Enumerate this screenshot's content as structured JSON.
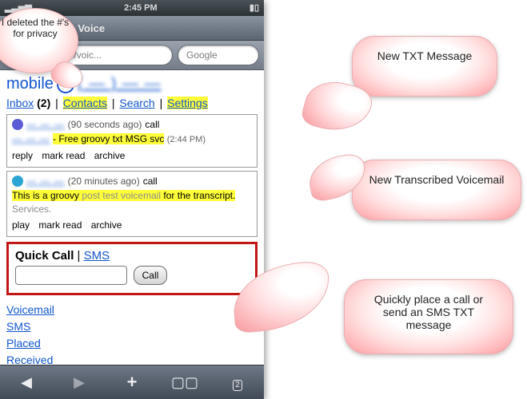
{
  "statusbar": {
    "time": "2:45 PM"
  },
  "topbar": {
    "title": "Google Voice"
  },
  "search": {
    "url_fragment": "/voic...",
    "placeholder": "Google"
  },
  "title": {
    "word": "mobile",
    "blurred_number": "( — )  — —"
  },
  "nav": {
    "inbox": "Inbox",
    "inbox_count": "(2)",
    "contacts": "Contacts",
    "search": "Search",
    "settings": "Settings"
  },
  "messages": [
    {
      "type": "sms",
      "from_blur": "—  — —",
      "ago": "(90 seconds ago)",
      "call": "call",
      "body_prefix_blur": "— — —",
      "body_hl": "- Free groovy txt MSG svc",
      "timestamp": "(2:44 PM)",
      "actions": {
        "a1": "reply",
        "a2": "mark read",
        "a3": "archive"
      }
    },
    {
      "type": "vm",
      "from_blur": "— — —",
      "ago": "(20 minutes ago)",
      "call": "call",
      "body_hl1": "This is a groovy",
      "body_faint": " post test voicemail ",
      "body_hl2": "for the",
      "body_hl3": " transcript. ",
      "body_faint2": "Services.",
      "actions": {
        "a1": "play",
        "a2": "mark read",
        "a3": "archive"
      }
    }
  ],
  "quickcall": {
    "title": "Quick Call",
    "sms": "SMS",
    "button": "Call"
  },
  "links": {
    "voicemail": "Voicemail",
    "sms": "SMS",
    "placed": "Placed",
    "received": "Received"
  },
  "bottombar": {
    "pages": "2"
  },
  "callouts": {
    "privacy": "I deleted the #'s for privacy",
    "txt": "New TXT Message",
    "vm": "New Transcribed Voicemail",
    "qc": "Quickly place a call or send an SMS TXT message"
  }
}
